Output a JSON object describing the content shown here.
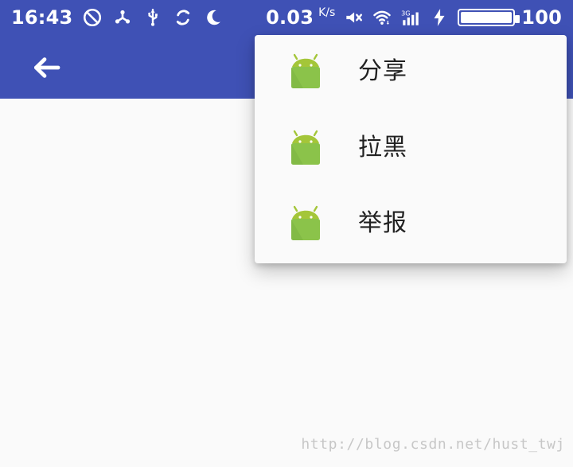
{
  "status_bar": {
    "time": "16:43",
    "network_speed": "0.03",
    "network_speed_unit": "K/s",
    "signal_label": "3G",
    "battery_level": "100",
    "icons": {
      "left": [
        "do-not-disturb-icon",
        "share-node-icon",
        "usb-icon",
        "sync-icon",
        "moon-icon"
      ],
      "right": [
        "mute-icon",
        "wifi-icon",
        "cellular-signal-icon",
        "charging-icon",
        "battery-icon"
      ]
    }
  },
  "app_bar": {
    "back_icon": "arrow-left-icon",
    "color": "#3f51b5"
  },
  "menu": {
    "items": [
      {
        "label": "分享",
        "icon": "android-icon"
      },
      {
        "label": "拉黑",
        "icon": "android-icon"
      },
      {
        "label": "举报",
        "icon": "android-icon"
      }
    ]
  },
  "watermark": {
    "text": "http://blog.csdn.net/hust_twj"
  }
}
